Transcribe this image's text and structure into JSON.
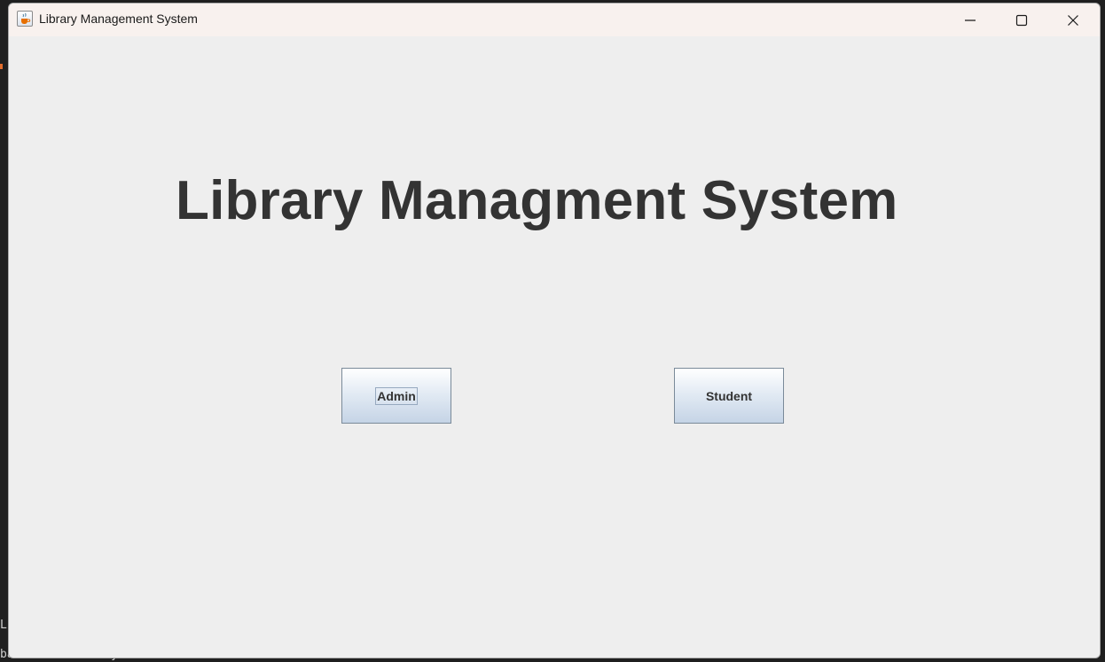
{
  "window": {
    "title": "Library Management System",
    "controls": {
      "minimize": "minimize-icon",
      "maximize": "maximize-icon",
      "close": "close-icon"
    }
  },
  "main": {
    "heading": "Library Managment System",
    "buttons": {
      "admin_label": "Admin",
      "student_label": "Student"
    }
  },
  "background": {
    "terminal_line": "base successfully connected",
    "terminal_fragment": "LE"
  },
  "colors": {
    "title_bar": "#f8f1ee",
    "content_bg": "#eeeeee",
    "heading_text": "#333333",
    "button_border": "#7a8a99"
  }
}
